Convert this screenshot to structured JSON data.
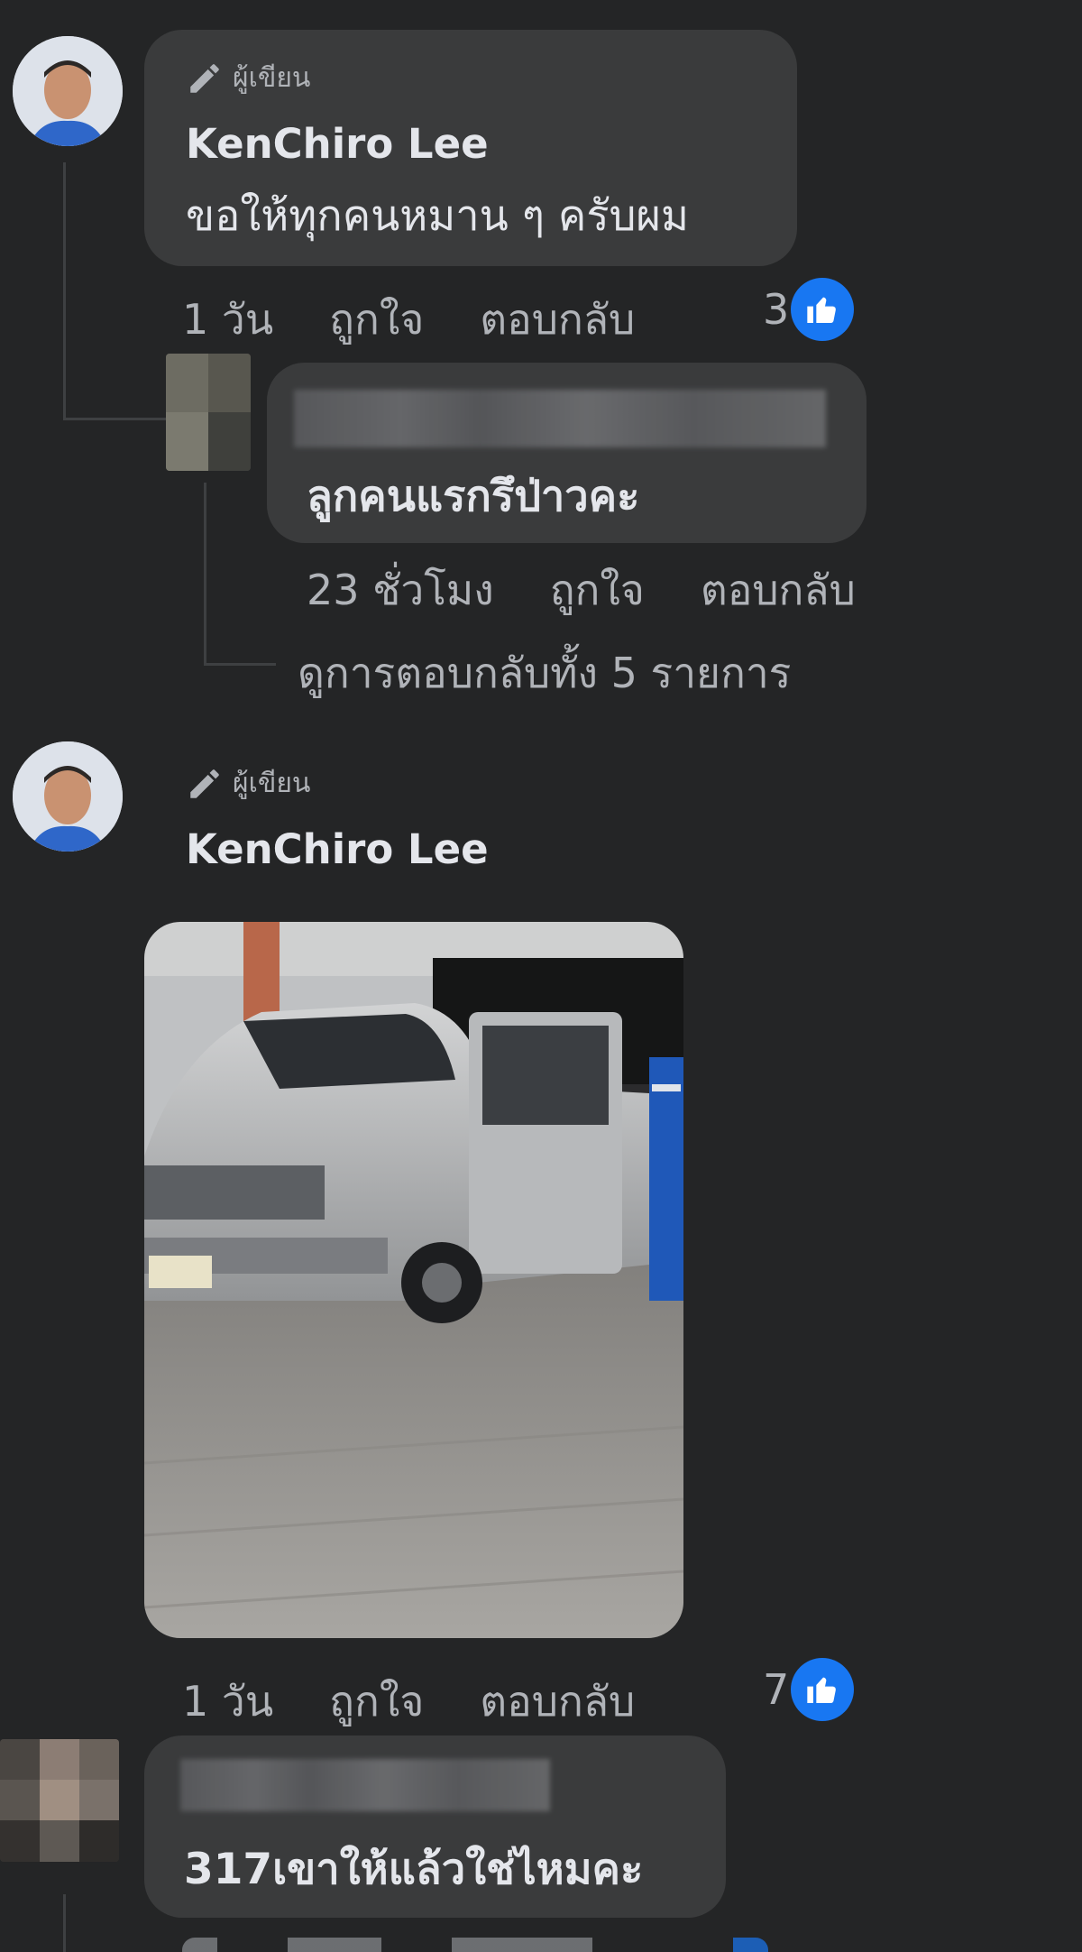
{
  "comments": [
    {
      "author_badge": "ผู้เขียน",
      "author": "KenChiro Lee",
      "text": "ขอให้ทุกคนหมาน ๆ ครับผม",
      "time": "1 วัน",
      "like_label": "ถูกใจ",
      "reply_label": "ตอบกลับ",
      "reaction_count": "3"
    },
    {
      "reply_text": "ลูกคนแรกรึป่าวคะ",
      "time": "23 ชั่วโมง",
      "like_label": "ถูกใจ",
      "reply_label": "ตอบกลับ",
      "view_replies": "ดูการตอบกลับทั้ง 5 รายการ"
    },
    {
      "author_badge": "ผู้เขียน",
      "author": "KenChiro Lee",
      "time": "1 วัน",
      "like_label": "ถูกใจ",
      "reply_label": "ตอบกลับ",
      "reaction_count": "7"
    },
    {
      "text": "317เขาให้แล้วใช่ไหมคะ"
    }
  ],
  "icons": {
    "author": "pencil-icon",
    "reaction": "thumbs-up-icon"
  },
  "colors": {
    "background": "#242526",
    "bubble": "#3a3b3c",
    "text": "#e4e6eb",
    "muted": "#b0b3b8",
    "like_blue": "#1877f2"
  }
}
